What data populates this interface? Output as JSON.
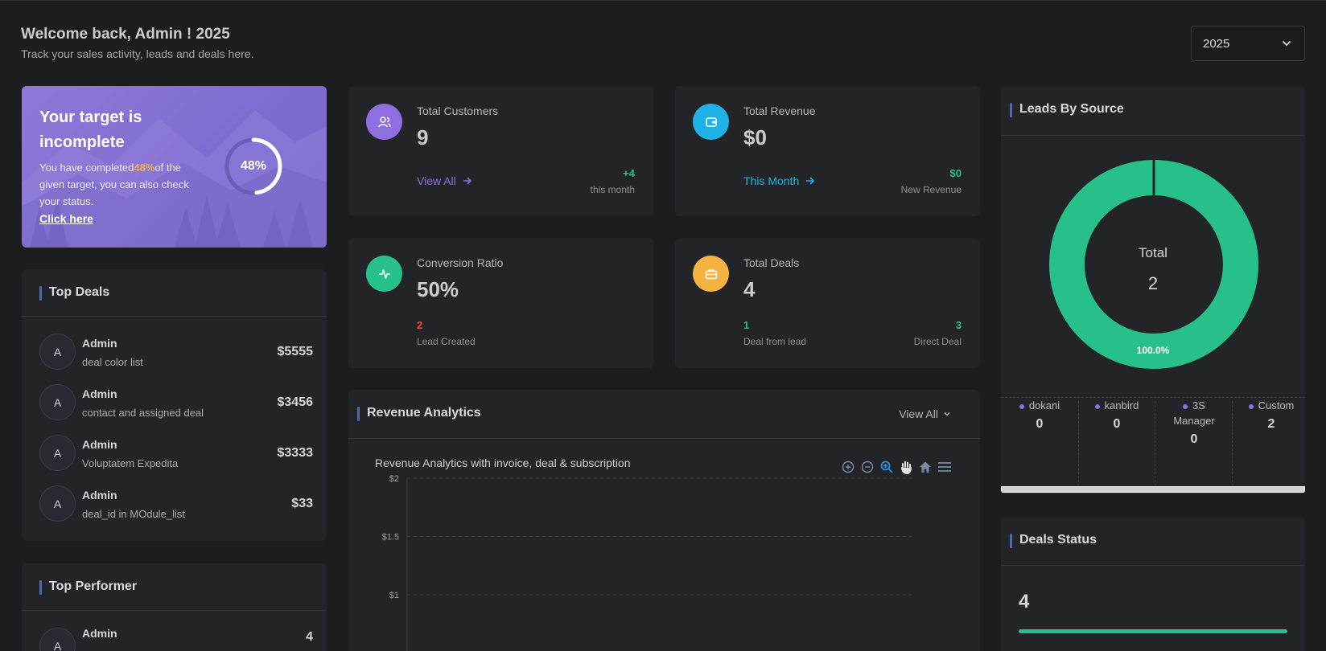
{
  "header": {
    "title": "Welcome back, Admin ! 2025",
    "subtitle": "Track your sales activity, leads and deals here.",
    "year_select": "2025"
  },
  "target": {
    "title": "Your target is incomplete",
    "text_before": "You have completed",
    "percent": "48%",
    "text_after": "of the given target, you can also check your status.",
    "link": "Click here",
    "ring_label": "48%",
    "progress": 0.48
  },
  "top_deals": {
    "title": "Top Deals",
    "items": [
      {
        "avatar": "A",
        "name": "Admin",
        "desc": "deal color list",
        "amount": "$5555"
      },
      {
        "avatar": "A",
        "name": "Admin",
        "desc": "contact and assigned deal",
        "amount": "$3456"
      },
      {
        "avatar": "A",
        "name": "Admin",
        "desc": "Voluptatem Expedita",
        "amount": "$3333"
      },
      {
        "avatar": "A",
        "name": "Admin",
        "desc": "deal_id in MOdule_list",
        "amount": "$33"
      }
    ]
  },
  "top_performer": {
    "title": "Top Performer",
    "items": [
      {
        "avatar": "A",
        "name": "Admin",
        "value": "4"
      }
    ]
  },
  "stats": {
    "customers": {
      "label": "Total Customers",
      "value": "9",
      "link": "View All",
      "delta": "+4",
      "delta_label": "this month"
    },
    "revenue": {
      "label": "Total Revenue",
      "value": "$0",
      "link": "This Month",
      "delta": "$0",
      "delta_label": "New Revenue"
    },
    "conversion": {
      "label": "Conversion Ratio",
      "value": "50%",
      "left_val": "2",
      "left_label": "Lead Created"
    },
    "deals": {
      "label": "Total Deals",
      "value": "4",
      "left_val": "1",
      "left_label": "Deal from lead",
      "right_val": "3",
      "right_label": "Direct Deal"
    }
  },
  "colors": {
    "accent_purple": "#8f6fe0",
    "accent_blue": "#1fb2e8",
    "accent_green": "#27c08a",
    "accent_orange": "#f5b342",
    "accent_red": "#e8503a"
  },
  "revenue_analytics": {
    "title": "Revenue Analytics",
    "view_all": "View All",
    "subtitle": "Revenue Analytics with invoice, deal & subscription",
    "tools": [
      "zoom-in-icon",
      "zoom-out-icon",
      "zoom-selection-icon",
      "pan-icon",
      "home-icon",
      "menu-icon"
    ]
  },
  "chart_data": {
    "type": "line",
    "title": "Revenue Analytics with invoice, deal & subscription",
    "y_ticks": [
      "$2",
      "$1.5",
      "$1"
    ],
    "ylim": [
      0,
      2
    ],
    "grid": true,
    "series": []
  },
  "leads_by_source": {
    "title": "Leads By Source",
    "total_label": "Total",
    "total_value": "2",
    "slice_label": "100.0%",
    "slice_color": "#27c08a",
    "sources": [
      {
        "name": "dokani",
        "value": "0"
      },
      {
        "name": "kanbird",
        "value": "0"
      },
      {
        "name": "3S Manager",
        "value": "0"
      },
      {
        "name": "Custom",
        "value": "2"
      }
    ]
  },
  "deals_status": {
    "title": "Deals Status",
    "value": "4",
    "progress": 1.0
  }
}
